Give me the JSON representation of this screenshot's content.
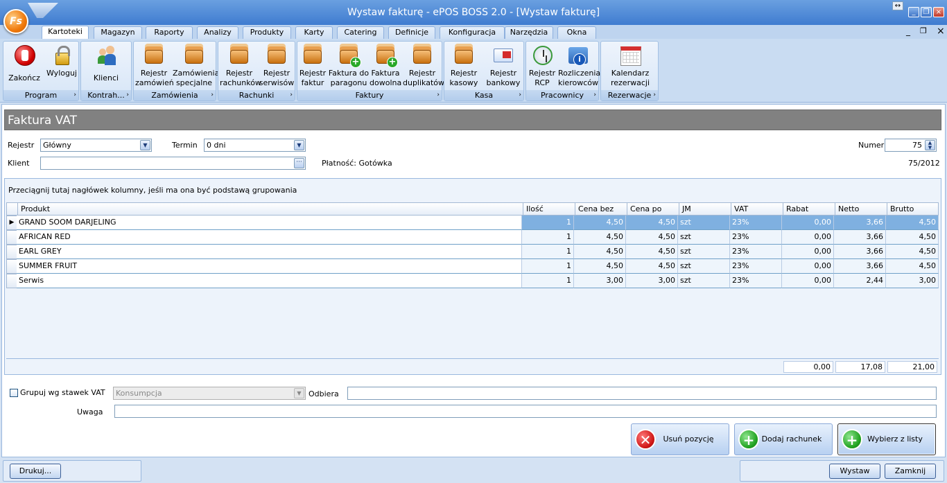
{
  "window": {
    "title": "Wystaw fakturę - ePOS BOSS 2.0 - [Wystaw fakturę]",
    "logo_text": "Fs",
    "minimize_glyph": "_",
    "restore_glyph": "❐",
    "close_glyph": "×",
    "resize_glyph": "↔",
    "mdi_minimize": "_",
    "mdi_restore": "❐",
    "mdi_close": "×"
  },
  "menu_tabs": [
    "Kartoteki",
    "Magazyn",
    "Raporty",
    "Analizy",
    "Produkty",
    "Karty",
    "Catering",
    "Definicje",
    "Konfiguracja",
    "Narzędzia",
    "Okna"
  ],
  "active_tab": "Kartoteki",
  "ribbon": {
    "groups": [
      {
        "title": "Program",
        "buttons": [
          {
            "label": "Zakończ",
            "icon": "stop-icon"
          },
          {
            "label": "Wyloguj",
            "icon": "lock-icon"
          }
        ]
      },
      {
        "title": "Kontrah...",
        "buttons": [
          {
            "label": "Klienci",
            "icon": "users-icon"
          }
        ]
      },
      {
        "title": "Zamówienia",
        "buttons": [
          {
            "label": "Rejestr zamówień",
            "icon": "register-book-icon"
          },
          {
            "label": "Zamówienia specjalne",
            "icon": "register-book-icon"
          }
        ]
      },
      {
        "title": "Rachunki",
        "buttons": [
          {
            "label": "Rejestr rachunków",
            "icon": "register-book-icon"
          },
          {
            "label": "Rejestr serwisów",
            "icon": "register-book-icon"
          }
        ]
      },
      {
        "title": "Faktury",
        "buttons": [
          {
            "label": "Rejestr faktur",
            "icon": "register-book-icon"
          },
          {
            "label": "Faktura do paragonu",
            "icon": "add-invoice-icon"
          },
          {
            "label": "Faktura dowolna",
            "icon": "add-invoice-icon"
          },
          {
            "label": "Rejestr duplikatów",
            "icon": "register-book-icon"
          }
        ]
      },
      {
        "title": "Kasa",
        "buttons": [
          {
            "label": "Rejestr kasowy",
            "icon": "register-book-icon"
          },
          {
            "label": "Rejestr bankowy",
            "icon": "bank-card-icon"
          }
        ]
      },
      {
        "title": "Pracownicy",
        "buttons": [
          {
            "label": "Rejestr RCP",
            "icon": "clock-icon"
          },
          {
            "label": "Rozliczenia kierowców",
            "icon": "info-icon"
          }
        ]
      },
      {
        "title": "Rezerwacje",
        "buttons": [
          {
            "label": "Kalendarz rezerwacji",
            "icon": "calendar-icon"
          }
        ]
      }
    ]
  },
  "form": {
    "title": "Faktura VAT",
    "rejestr_label": "Rejestr",
    "rejestr_value": "Główny",
    "termin_label": "Termin",
    "termin_value": "0 dni",
    "numer_label": "Numer",
    "numer_value": "75",
    "klient_label": "Klient",
    "klient_value": "",
    "platnosc": "Płatność: Gotówka",
    "doc_number": "75/2012",
    "ellipsis_glyph": "···"
  },
  "grid": {
    "group_hint": "Przeciągnij tutaj nagłówek kolumny, jeśli ma ona być podstawą grupowania",
    "columns": [
      "Produkt",
      "Ilość",
      "Cena bez",
      "Cena po rab.",
      "JM",
      "VAT",
      "Rabat",
      "Netto",
      "Brutto"
    ],
    "rows": [
      [
        "GRAND SOOM DARJELING",
        "1",
        "4,50",
        "4,50",
        "szt",
        "23%",
        "0,00",
        "3,66",
        "4,50"
      ],
      [
        "AFRICAN RED",
        "1",
        "4,50",
        "4,50",
        "szt",
        "23%",
        "0,00",
        "3,66",
        "4,50"
      ],
      [
        "EARL GREY",
        "1",
        "4,50",
        "4,50",
        "szt",
        "23%",
        "0,00",
        "3,66",
        "4,50"
      ],
      [
        "SUMMER FRUIT",
        "1",
        "4,50",
        "4,50",
        "szt",
        "23%",
        "0,00",
        "3,66",
        "4,50"
      ],
      [
        "Serwis",
        "1",
        "3,00",
        "3,00",
        "szt",
        "23%",
        "0,00",
        "2,44",
        "3,00"
      ]
    ],
    "selected_row": 0,
    "row_marker": "▶",
    "totals": {
      "rabat": "0,00",
      "netto": "17,08",
      "brutto": "21,00"
    }
  },
  "bottom": {
    "grupuj_label": "Grupuj wg stawek VAT",
    "grupuj_checked": false,
    "konsumpcja_value": "Konsumpcja",
    "odbiera_label": "Odbiera",
    "odbiera_value": "",
    "uwaga_label": "Uwaga",
    "uwaga_value": "",
    "usun_label": "Usuń pozycję",
    "dodaj_label": "Dodaj rachunek",
    "wybierz_label": "Wybierz z listy",
    "drukuj_label": "Drukuj...",
    "wystaw_label": "Wystaw",
    "zamknij_label": "Zamknij"
  },
  "colors": {
    "title_bar": "#3f7cd0",
    "selected_row": "#7fb0e0",
    "header_band": "#818181",
    "row_bg": "#eef5fc"
  }
}
